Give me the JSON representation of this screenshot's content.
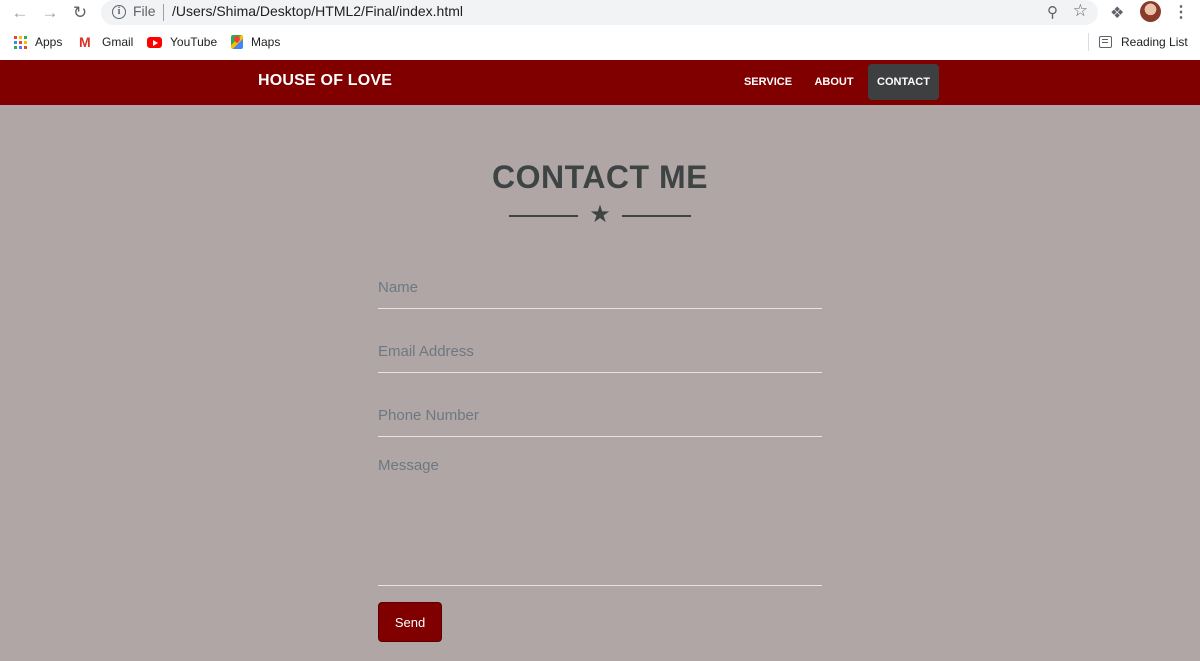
{
  "browser": {
    "omnibox_scheme": "File",
    "url": "/Users/Shima/Desktop/HTML2/Final/index.html",
    "bookmarks": [
      {
        "label": "Apps",
        "icon": "apps-grid-icon"
      },
      {
        "label": "Gmail",
        "icon": "gmail-icon"
      },
      {
        "label": "YouTube",
        "icon": "youtube-icon"
      },
      {
        "label": "Maps",
        "icon": "maps-icon"
      }
    ],
    "reading_list": "Reading List"
  },
  "site": {
    "brand": "HOUSE OF LOVE",
    "nav": [
      {
        "label": "SERVICE",
        "active": false
      },
      {
        "label": "ABOUT",
        "active": false
      },
      {
        "label": "CONTACT",
        "active": true
      }
    ],
    "accent_color": "#800000",
    "background_color": "#b0a6a6"
  },
  "contact": {
    "title": "CONTACT ME",
    "divider_icon": "star-icon",
    "fields": {
      "name": {
        "value": "",
        "placeholder": "Name"
      },
      "email": {
        "value": "",
        "placeholder": "Email Address"
      },
      "phone": {
        "value": "",
        "placeholder": "Phone Number"
      },
      "message": {
        "value": "",
        "placeholder": "Message"
      }
    },
    "send_label": "Send"
  }
}
